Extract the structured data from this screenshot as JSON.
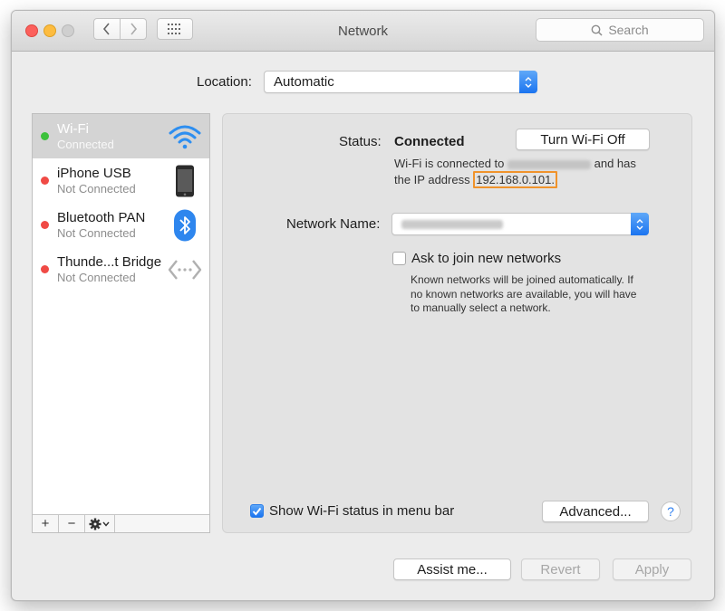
{
  "window": {
    "title": "Network"
  },
  "toolbar": {
    "search_placeholder": "Search"
  },
  "location": {
    "label": "Location:",
    "value": "Automatic"
  },
  "sidebar": {
    "items": [
      {
        "name": "Wi-Fi",
        "status": "Connected",
        "status_color": "#3cc13b",
        "icon": "wifi-icon",
        "selected": true
      },
      {
        "name": "iPhone USB",
        "status": "Not Connected",
        "status_color": "#f04a45",
        "icon": "iphone-icon"
      },
      {
        "name": "Bluetooth PAN",
        "status": "Not Connected",
        "status_color": "#f04a45",
        "icon": "bluetooth-icon"
      },
      {
        "name": "Thunde...t Bridge",
        "status": "Not Connected",
        "status_color": "#f04a45",
        "icon": "thunderbolt-bridge-icon"
      }
    ],
    "footer": {
      "add": "+",
      "remove": "−"
    }
  },
  "main": {
    "status_label": "Status:",
    "status_value": "Connected",
    "turn_off_button": "Turn Wi-Fi Off",
    "desc_line1_prefix": "Wi-Fi is connected to",
    "desc_line1_suffix": "and has",
    "desc_line2_prefix": "the IP address",
    "ip_address": "192.168.0.101.",
    "network_name_label": "Network Name:",
    "ask_to_join_label": "Ask to join new networks",
    "ask_desc": [
      "Known networks will be joined automatically. If",
      "no known networks are available, you will have",
      "to manually select a network."
    ],
    "show_status_label": "Show Wi-Fi status in menu bar",
    "show_status_checked": true,
    "ask_to_join_checked": false,
    "advanced_button": "Advanced...",
    "help_button": "?"
  },
  "bottom": {
    "assist_button": "Assist me...",
    "revert_button": "Revert",
    "apply_button": "Apply"
  },
  "colors": {
    "accent": "#1b74f0",
    "highlight": "#f0932b"
  }
}
